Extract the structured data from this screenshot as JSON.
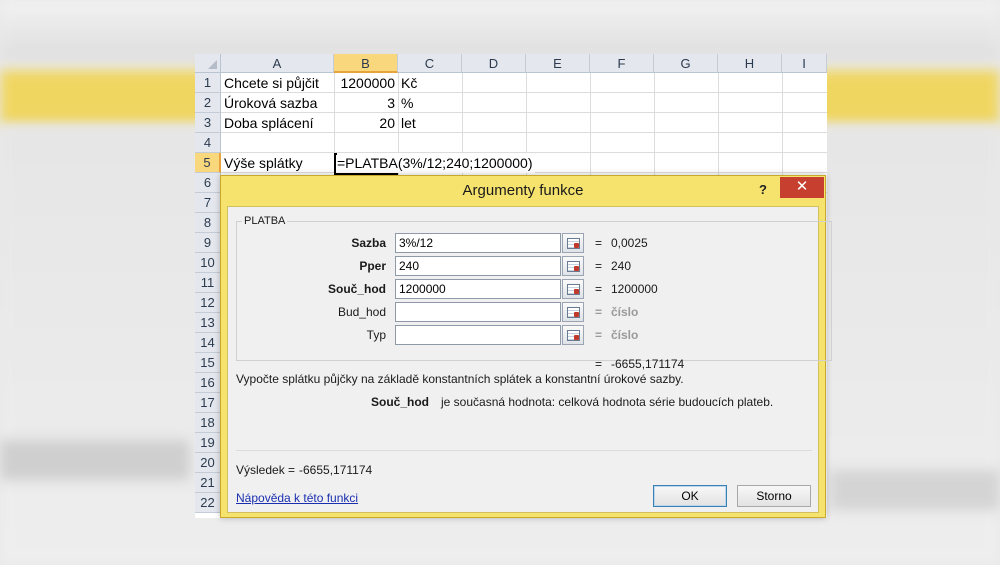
{
  "sheet": {
    "columns": [
      "A",
      "B",
      "C",
      "D",
      "E",
      "F",
      "G",
      "H",
      "I"
    ],
    "active_column": "B",
    "rows": [
      "1",
      "2",
      "3",
      "4",
      "5",
      "6",
      "7",
      "8",
      "9",
      "10",
      "11",
      "12",
      "13",
      "14",
      "15",
      "16",
      "17",
      "18",
      "19",
      "20",
      "21",
      "22"
    ],
    "active_row": "5",
    "cells": {
      "r1": {
        "a": "Chcete si půjčit",
        "b": "1200000",
        "c": "Kč"
      },
      "r2": {
        "a": "Úroková sazba",
        "b": "3",
        "c": "%"
      },
      "r3": {
        "a": "Doba splácení",
        "b": "20",
        "c": "let"
      },
      "r5": {
        "a": "Výše splátky",
        "formula": "=PLATBA(3%/12;240;1200000)"
      }
    }
  },
  "dialog": {
    "title": "Argumenty funkce",
    "help": "?",
    "close": "✕",
    "function_name": "PLATBA",
    "args": [
      {
        "label": "Sazba",
        "value": "3%/12",
        "result": "0,0025",
        "bold": true
      },
      {
        "label": "Pper",
        "value": "240",
        "result": "240",
        "bold": true
      },
      {
        "label": "Souč_hod",
        "value": "1200000",
        "result": "1200000",
        "bold": true
      },
      {
        "label": "Bud_hod",
        "value": "",
        "result": "číslo",
        "bold": false
      },
      {
        "label": "Typ",
        "value": "",
        "result": "číslo",
        "bold": false
      }
    ],
    "eq": "=",
    "formula_result": "-6655,171174",
    "description": "Vypočte splátku půjčky na základě konstantních splátek a konstantní úrokové sazby.",
    "arg_help_name": "Souč_hod",
    "arg_help_text": "je současná hodnota: celková hodnota série budoucích plateb.",
    "result_label": "Výsledek =",
    "result_value": "-6655,171174",
    "help_link": "Nápověda k této funkci",
    "ok_label": "OK",
    "cancel_label": "Storno"
  },
  "colors": {
    "dialog_frame": "#f6e36e",
    "close_button": "#c7402f",
    "active_header": "#f9d77d",
    "link": "#1a2fb0"
  }
}
